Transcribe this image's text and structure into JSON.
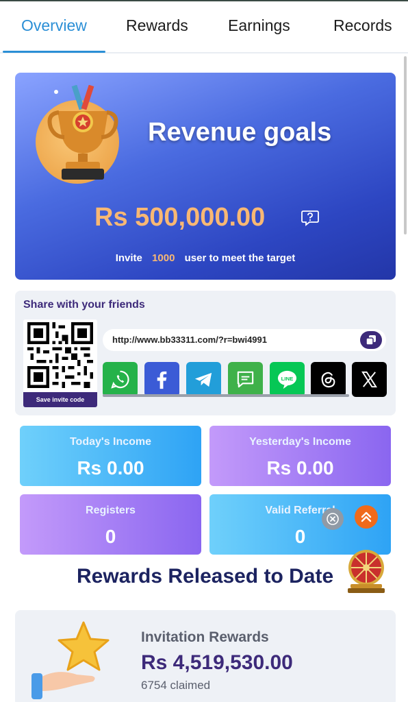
{
  "tabs": [
    {
      "label": "Overview",
      "active": true
    },
    {
      "label": "Rewards",
      "active": false
    },
    {
      "label": "Earnings",
      "active": false
    },
    {
      "label": "Records",
      "active": false
    }
  ],
  "goal": {
    "title": "Revenue goals",
    "amount": "Rs 500,000.00",
    "invite_prefix": "Invite",
    "invite_count": "1000",
    "invite_suffix": "user to meet the target"
  },
  "share": {
    "title": "Share with your friends",
    "qr_save_label": "Save invite code",
    "url": "http://www.bb33311.com/?r=bwi4991",
    "platforms": [
      {
        "name": "whatsapp",
        "color": "#25b24a"
      },
      {
        "name": "facebook",
        "color": "#3b5bd6"
      },
      {
        "name": "telegram",
        "color": "#229ed9"
      },
      {
        "name": "sms",
        "color": "#3fb14a"
      },
      {
        "name": "line",
        "color": "#06c755"
      },
      {
        "name": "threads",
        "color": "#000000"
      },
      {
        "name": "x",
        "color": "#000000"
      }
    ],
    "line_label": "LINE"
  },
  "stats": {
    "today_label": "Today's Income",
    "today_value": "Rs 0.00",
    "yesterday_label": "Yesterday's Income",
    "yesterday_value": "Rs 0.00",
    "registers_label": "Registers",
    "registers_value": "0",
    "valid_label": "Valid Referral",
    "valid_value": "0"
  },
  "released_title": "Rewards Released to Date",
  "invitation": {
    "title": "Invitation Rewards",
    "amount": "Rs 4,519,530.00",
    "claimed": "6754 claimed"
  },
  "colors": {
    "accent": "#2b8fd6",
    "brand_purple": "#3d2a7a",
    "gold": "#f8b874"
  }
}
